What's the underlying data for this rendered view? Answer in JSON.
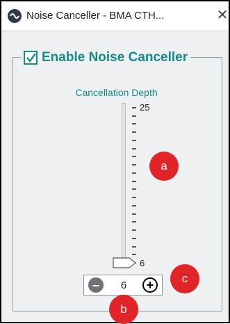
{
  "window": {
    "title": "Noise Canceller - BMA CTH...",
    "close_symbol": "✕",
    "app_icon": "noise-canceller-app-icon"
  },
  "group": {
    "enable_label": "Enable Noise Canceller",
    "enable_checked": true
  },
  "slider": {
    "label": "Cancellation Depth",
    "max_label": "25",
    "min_label": "6",
    "value": 6,
    "min": 6,
    "max": 25
  },
  "stepper": {
    "value": "6",
    "minus_icon": "minus-circle-icon",
    "plus_icon": "plus-circle-icon"
  },
  "callouts": {
    "a": "a",
    "b": "b",
    "c": "c"
  },
  "colors": {
    "accent": "#158a8a",
    "callout": "#e02427"
  }
}
